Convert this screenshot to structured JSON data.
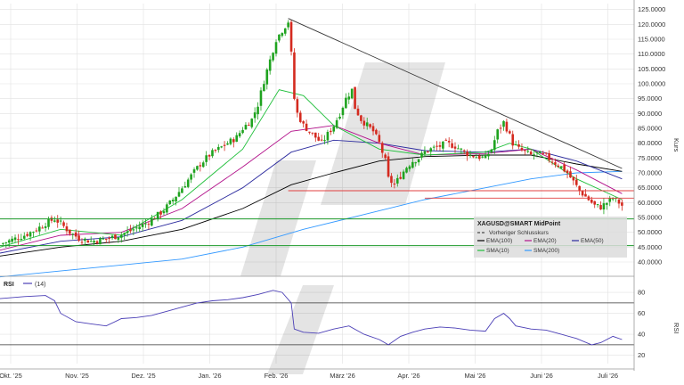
{
  "chart_data": [
    {
      "type": "candlestick",
      "ylabel": "Kurs",
      "ylim": [
        37,
        127
      ],
      "yticks": [
        40,
        45,
        50,
        55,
        60,
        65,
        70,
        75,
        80,
        85,
        90,
        95,
        100,
        105,
        110,
        115,
        120,
        125
      ],
      "yticks_labels": [
        "40.0000",
        "45.0000",
        "50.0000",
        "55.0000",
        "60.0000",
        "65.0000",
        "70.0000",
        "75.0000",
        "80.0000",
        "85.0000",
        "90.0000",
        "95.0000",
        "100.0000",
        "105.0000",
        "110.0000",
        "115.0000",
        "120.0000",
        "125.0000"
      ],
      "x_month_labels": [
        "Okt. '25",
        "Nov. '25",
        "Dez. '25",
        "Jan. '26",
        "Feb. '26",
        "März '26",
        "Apr. '26",
        "Mai '26",
        "Juni '26",
        "Juli '26"
      ],
      "grid": true,
      "close_path": [
        [
          0,
          46
        ],
        [
          4,
          47.5
        ],
        [
          8,
          49
        ],
        [
          12,
          51
        ],
        [
          15,
          53
        ],
        [
          18,
          54.5
        ],
        [
          20,
          53
        ],
        [
          23,
          50
        ],
        [
          26,
          48
        ],
        [
          30,
          47
        ],
        [
          33,
          47.5
        ],
        [
          36,
          48
        ],
        [
          39,
          49
        ],
        [
          42,
          50
        ],
        [
          45,
          51.5
        ],
        [
          48,
          53
        ],
        [
          51,
          55
        ],
        [
          54,
          57.5
        ],
        [
          57,
          61
        ],
        [
          60,
          65
        ],
        [
          63,
          69
        ],
        [
          66,
          73
        ],
        [
          69,
          76
        ],
        [
          72,
          78
        ],
        [
          75,
          80
        ],
        [
          78,
          82
        ],
        [
          80,
          85
        ],
        [
          83,
          88
        ],
        [
          85,
          93
        ],
        [
          87,
          101
        ],
        [
          89,
          108
        ],
        [
          91,
          115
        ],
        [
          93,
          118
        ],
        [
          95,
          121
        ],
        [
          96,
          110
        ],
        [
          97,
          95
        ],
        [
          98,
          90
        ],
        [
          100,
          86
        ],
        [
          102,
          84
        ],
        [
          104,
          82
        ],
        [
          106,
          80
        ],
        [
          108,
          83
        ],
        [
          110,
          86
        ],
        [
          112,
          90
        ],
        [
          114,
          95
        ],
        [
          116,
          98
        ],
        [
          117,
          92
        ],
        [
          119,
          88
        ],
        [
          121,
          86
        ],
        [
          123,
          84
        ],
        [
          125,
          80
        ],
        [
          127,
          74
        ],
        [
          128,
          68
        ],
        [
          130,
          66
        ],
        [
          132,
          69
        ],
        [
          134,
          72
        ],
        [
          136,
          74
        ],
        [
          138,
          75
        ],
        [
          140,
          77
        ],
        [
          142,
          78
        ],
        [
          145,
          79
        ],
        [
          147,
          80
        ],
        [
          150,
          79
        ],
        [
          153,
          77
        ],
        [
          155,
          76
        ],
        [
          157,
          75.5
        ],
        [
          160,
          75
        ],
        [
          162,
          78
        ],
        [
          164,
          84
        ],
        [
          166,
          87
        ],
        [
          167,
          85
        ],
        [
          169,
          80
        ],
        [
          171,
          78
        ],
        [
          173,
          77
        ],
        [
          175,
          76
        ],
        [
          177,
          76.5
        ],
        [
          180,
          75.5
        ],
        [
          182,
          74
        ],
        [
          185,
          72
        ],
        [
          187,
          70
        ],
        [
          189,
          67
        ],
        [
          191,
          64
        ],
        [
          193,
          62
        ],
        [
          195,
          60
        ],
        [
          196,
          59
        ],
        [
          198,
          58.5
        ],
        [
          200,
          60
        ],
        [
          202,
          61.5
        ],
        [
          204,
          60
        ],
        [
          205,
          59
        ]
      ],
      "indicators": {
        "ema100_path": [
          [
            0,
            42
          ],
          [
            20,
            45
          ],
          [
            40,
            47
          ],
          [
            60,
            51
          ],
          [
            80,
            58
          ],
          [
            96,
            66
          ],
          [
            110,
            70
          ],
          [
            125,
            74
          ],
          [
            140,
            75.5
          ],
          [
            160,
            76
          ],
          [
            175,
            76
          ],
          [
            190,
            73
          ],
          [
            205,
            70.5
          ]
        ],
        "ema20_path": [
          [
            0,
            44
          ],
          [
            20,
            49
          ],
          [
            40,
            50
          ],
          [
            60,
            58
          ],
          [
            80,
            72
          ],
          [
            96,
            84
          ],
          [
            110,
            86
          ],
          [
            125,
            80
          ],
          [
            140,
            76
          ],
          [
            160,
            76.5
          ],
          [
            175,
            78
          ],
          [
            190,
            71
          ],
          [
            205,
            63
          ]
        ],
        "ema50_path": [
          [
            0,
            43
          ],
          [
            20,
            47
          ],
          [
            40,
            48.5
          ],
          [
            60,
            54
          ],
          [
            80,
            65
          ],
          [
            96,
            77
          ],
          [
            110,
            81
          ],
          [
            125,
            80
          ],
          [
            140,
            77.5
          ],
          [
            160,
            77
          ],
          [
            175,
            78
          ],
          [
            190,
            74
          ],
          [
            205,
            68
          ]
        ],
        "sma10_path": [
          [
            0,
            45
          ],
          [
            20,
            51
          ],
          [
            40,
            49
          ],
          [
            60,
            61
          ],
          [
            80,
            78
          ],
          [
            92,
            98
          ],
          [
            100,
            96
          ],
          [
            110,
            86
          ],
          [
            125,
            78
          ],
          [
            140,
            76
          ],
          [
            160,
            77
          ],
          [
            168,
            80
          ],
          [
            175,
            78
          ],
          [
            190,
            68
          ],
          [
            205,
            61
          ]
        ],
        "sma200_path": [
          [
            0,
            35
          ],
          [
            30,
            38
          ],
          [
            60,
            41
          ],
          [
            80,
            45
          ],
          [
            100,
            51
          ],
          [
            120,
            56
          ],
          [
            140,
            61
          ],
          [
            160,
            65
          ],
          [
            175,
            68
          ],
          [
            190,
            70
          ],
          [
            205,
            70.5
          ]
        ]
      },
      "lines": {
        "trendline": [
          [
            95,
            122
          ],
          [
            205,
            71.5
          ]
        ],
        "horizontal_red_1": {
          "from": 95,
          "value": 64
        },
        "horizontal_red_2": {
          "from": 140,
          "value": 61.5
        },
        "horizontal_green_1": {
          "from": 0,
          "value": 54.5
        },
        "horizontal_green_2": {
          "from": 0,
          "value": 45.5
        }
      },
      "legend": {
        "placement": "bottom-right",
        "title": "XAGUSD@SMART MidPoint",
        "line2": "Vorheriger Schlusskurs",
        "entries": [
          {
            "label": "EMA(100)",
            "color": "#000000"
          },
          {
            "label": "EMA(20)",
            "color": "#b2108a"
          },
          {
            "label": "EMA(50)",
            "color": "#2b2a9e"
          },
          {
            "label": "SMA(10)",
            "color": "#1fbf3a"
          },
          {
            "label": "SMA(200)",
            "color": "#3399ff"
          }
        ]
      }
    },
    {
      "type": "line",
      "title": "RSI",
      "series_label": "(14)",
      "ylabel": "RSI",
      "ylim": [
        12,
        92
      ],
      "yticks": [
        20,
        40,
        60,
        80
      ],
      "reference_lines": [
        70,
        30
      ],
      "values_path": [
        [
          0,
          74
        ],
        [
          8,
          76
        ],
        [
          15,
          77
        ],
        [
          18,
          72
        ],
        [
          20,
          60
        ],
        [
          25,
          52
        ],
        [
          30,
          50
        ],
        [
          35,
          48
        ],
        [
          40,
          55
        ],
        [
          45,
          56
        ],
        [
          50,
          58
        ],
        [
          55,
          62
        ],
        [
          60,
          66
        ],
        [
          65,
          70
        ],
        [
          70,
          72
        ],
        [
          75,
          73
        ],
        [
          80,
          75
        ],
        [
          85,
          78
        ],
        [
          90,
          82
        ],
        [
          93,
          80
        ],
        [
          96,
          70
        ],
        [
          97,
          45
        ],
        [
          100,
          42
        ],
        [
          105,
          41
        ],
        [
          110,
          45
        ],
        [
          115,
          48
        ],
        [
          120,
          40
        ],
        [
          125,
          35
        ],
        [
          128,
          30
        ],
        [
          132,
          38
        ],
        [
          136,
          42
        ],
        [
          140,
          45
        ],
        [
          145,
          47
        ],
        [
          150,
          46
        ],
        [
          155,
          44
        ],
        [
          160,
          43
        ],
        [
          163,
          55
        ],
        [
          166,
          60
        ],
        [
          168,
          55
        ],
        [
          170,
          48
        ],
        [
          175,
          45
        ],
        [
          180,
          44
        ],
        [
          185,
          40
        ],
        [
          190,
          36
        ],
        [
          195,
          30
        ],
        [
          198,
          32
        ],
        [
          202,
          38
        ],
        [
          205,
          35
        ]
      ]
    }
  ],
  "colors": {
    "up": "#1fa31f",
    "down": "#d42a1f",
    "trend": "#333333",
    "red_line": "#e04040",
    "green_line": "#1b9a2a",
    "rsi_line": "#4b3fb6",
    "grid": "#e1e1e1"
  }
}
